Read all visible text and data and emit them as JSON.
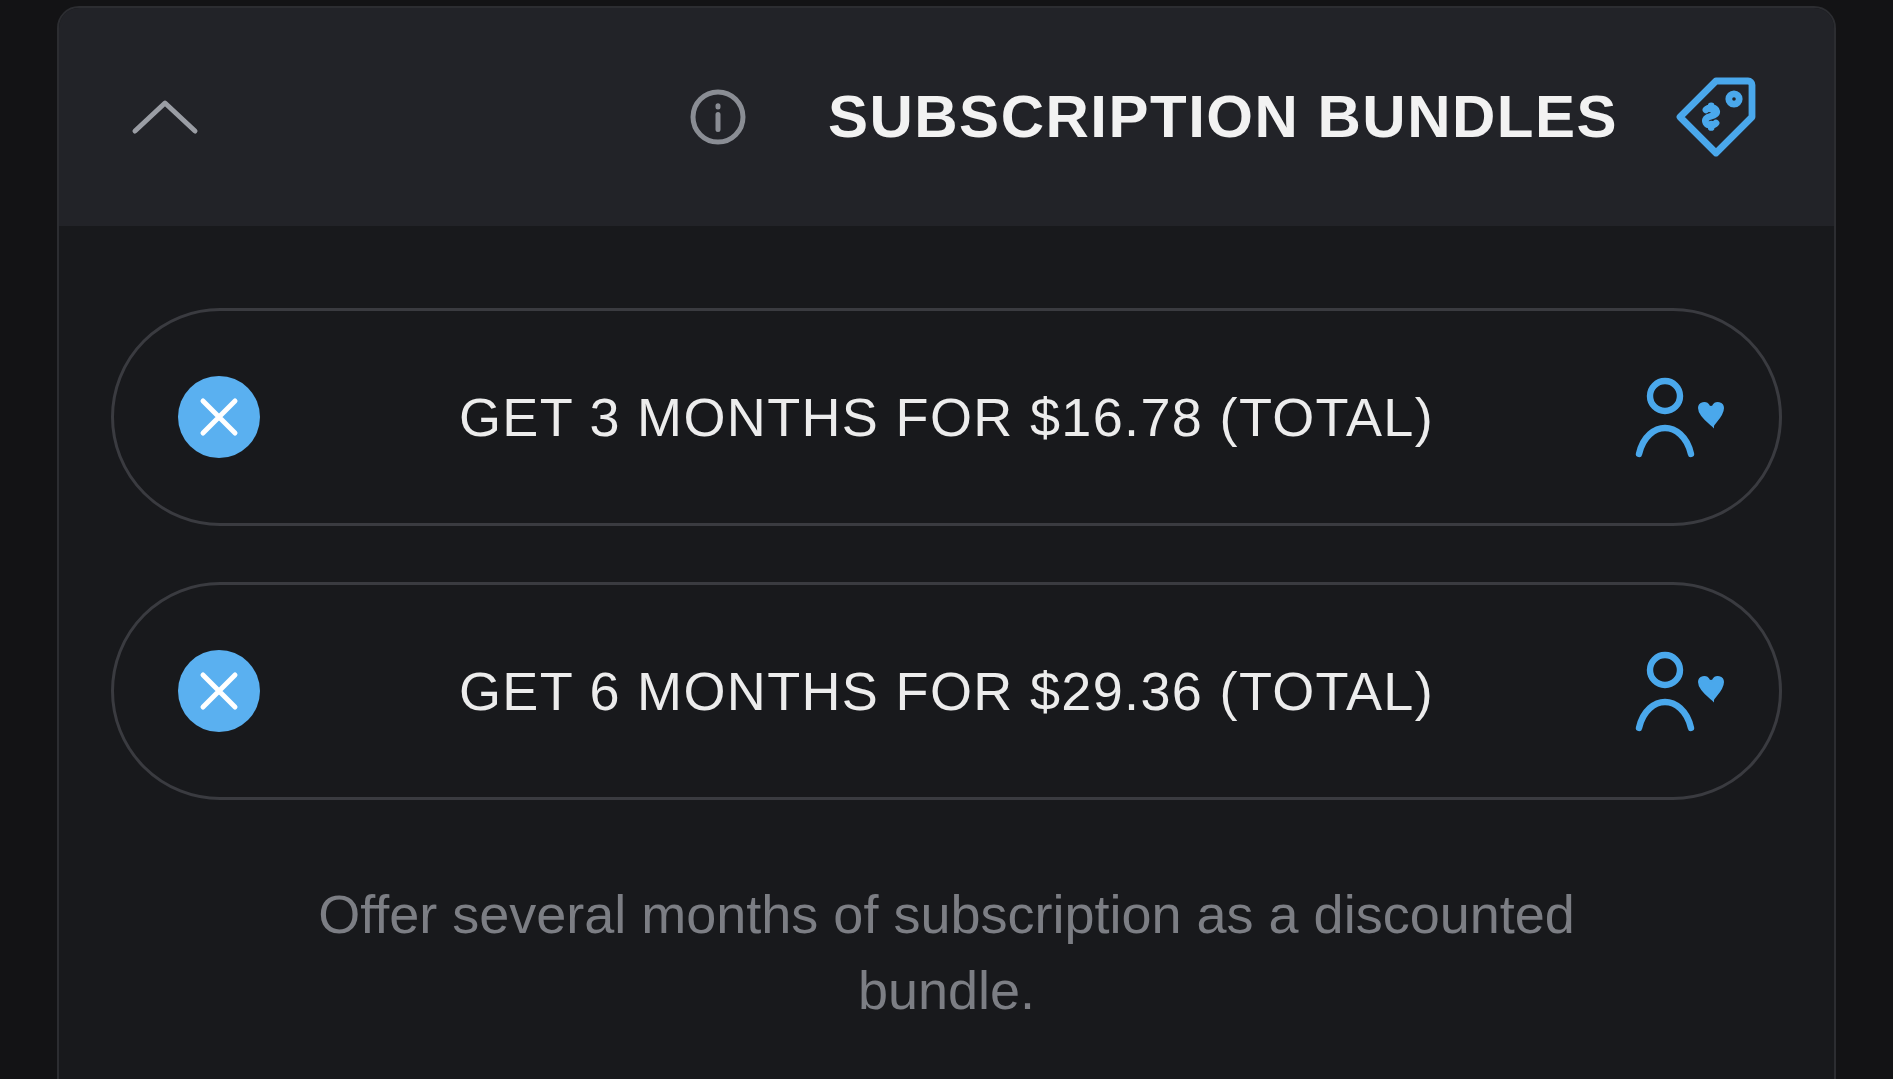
{
  "panel": {
    "title": "SUBSCRIPTION BUNDLES",
    "expanded": true
  },
  "bundles": [
    {
      "label": "GET 3 MONTHS FOR $16.78 (TOTAL)"
    },
    {
      "label": "GET 6 MONTHS FOR $29.36 (TOTAL)"
    }
  ],
  "description": "Offer several months of subscription as a discounted bundle."
}
